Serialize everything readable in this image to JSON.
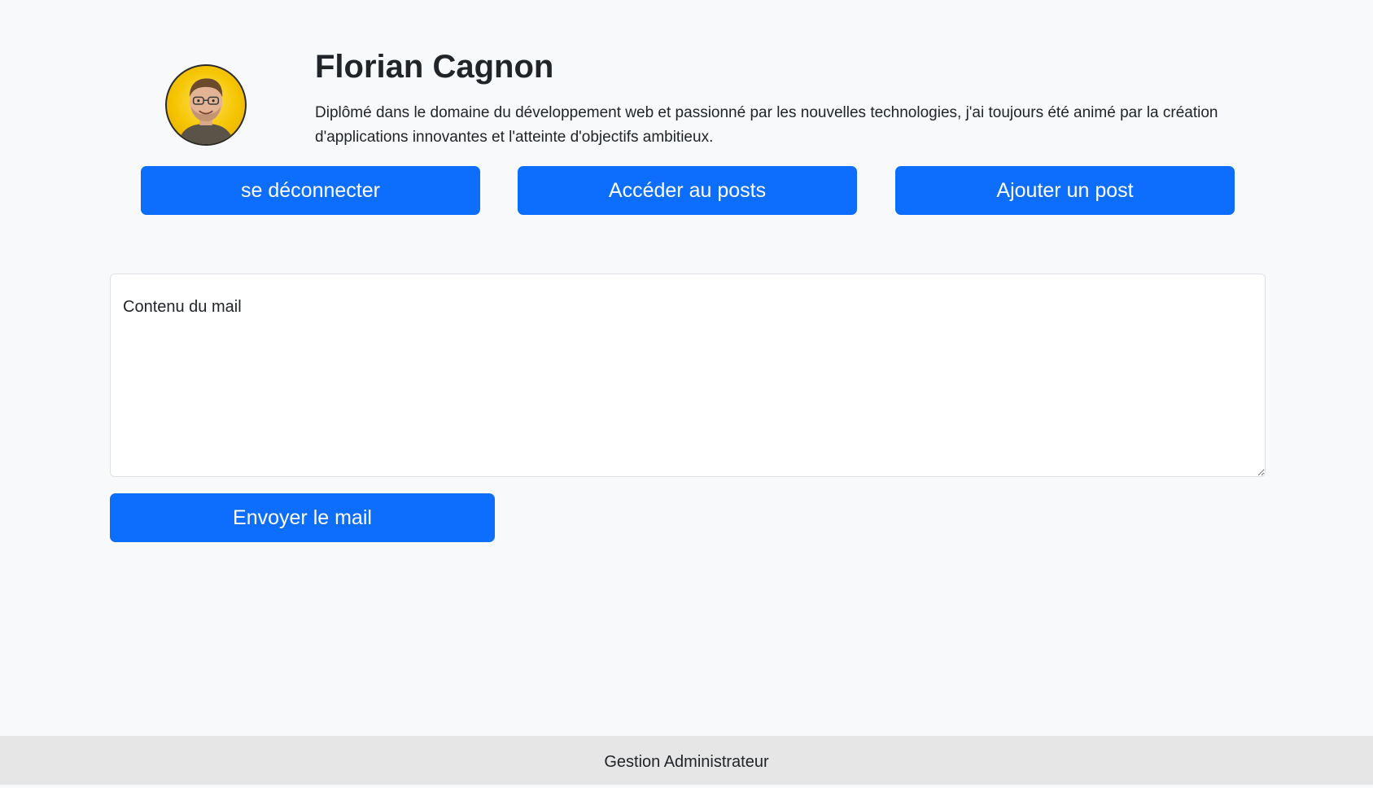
{
  "profile": {
    "name": "Florian Cagnon",
    "bio": "Diplômé dans le domaine du développement web et passionné par les nouvelles technologies, j'ai toujours été animé par la création d'applications innovantes et l'atteinte d'objectifs ambitieux."
  },
  "actions": {
    "logout_label": "se déconnecter",
    "posts_label": "Accéder au posts",
    "add_post_label": "Ajouter un post"
  },
  "mail_form": {
    "placeholder": "Contenu du mail",
    "value": "",
    "send_label": "Envoyer le mail"
  },
  "footer": {
    "text": "Gestion Administrateur"
  },
  "colors": {
    "primary": "#0d6efd",
    "background": "#f8f9fa",
    "footer_background": "#e6e6e6",
    "text": "#212529"
  }
}
